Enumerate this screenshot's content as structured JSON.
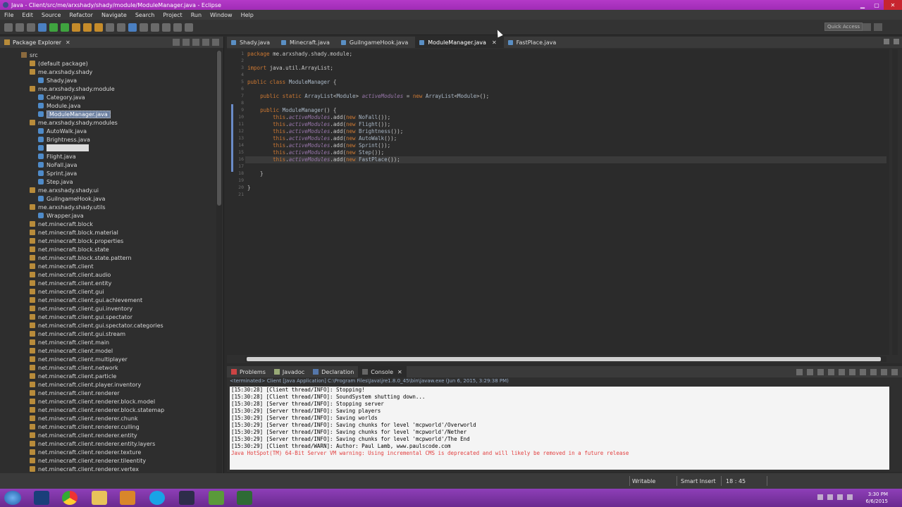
{
  "window": {
    "title": "Java - Client/src/me/arxshady/shady/module/ModuleManager.java - Eclipse"
  },
  "menu": [
    "File",
    "Edit",
    "Source",
    "Refactor",
    "Navigate",
    "Search",
    "Project",
    "Run",
    "Window",
    "Help"
  ],
  "toolbar": {
    "quick_access": "Quick Access"
  },
  "package_explorer": {
    "title": "Package Explorer",
    "tree": [
      {
        "label": "src",
        "kind": "src",
        "indent": 0
      },
      {
        "label": "(default package)",
        "kind": "pkg",
        "indent": 1
      },
      {
        "label": "me.arxshady.shady",
        "kind": "pkg",
        "indent": 1
      },
      {
        "label": "Shady.java",
        "kind": "file",
        "indent": 2
      },
      {
        "label": "me.arxshady.shady.module",
        "kind": "pkg",
        "indent": 1
      },
      {
        "label": "Category.java",
        "kind": "file",
        "indent": 2
      },
      {
        "label": "Module.java",
        "kind": "file",
        "indent": 2
      },
      {
        "label": "ModuleManager.java",
        "kind": "file",
        "indent": 2,
        "selected": true
      },
      {
        "label": "me.arxshady.shady.modules",
        "kind": "pkg",
        "indent": 1
      },
      {
        "label": "AutoWalk.java",
        "kind": "file",
        "indent": 2
      },
      {
        "label": "Brightness.java",
        "kind": "file",
        "indent": 2
      },
      {
        "label": "",
        "kind": "file",
        "indent": 2,
        "editing": true
      },
      {
        "label": "Flight.java",
        "kind": "file",
        "indent": 2
      },
      {
        "label": "NoFall.java",
        "kind": "file",
        "indent": 2
      },
      {
        "label": "Sprint.java",
        "kind": "file",
        "indent": 2
      },
      {
        "label": "Step.java",
        "kind": "file",
        "indent": 2
      },
      {
        "label": "me.arxshady.shady.ui",
        "kind": "pkg",
        "indent": 1
      },
      {
        "label": "GuiIngameHook.java",
        "kind": "file",
        "indent": 2
      },
      {
        "label": "me.arxshady.shady.utils",
        "kind": "pkg",
        "indent": 1
      },
      {
        "label": "Wrapper.java",
        "kind": "file",
        "indent": 2
      },
      {
        "label": "net.minecraft.block",
        "kind": "pkg",
        "indent": 1
      },
      {
        "label": "net.minecraft.block.material",
        "kind": "pkg",
        "indent": 1
      },
      {
        "label": "net.minecraft.block.properties",
        "kind": "pkg",
        "indent": 1
      },
      {
        "label": "net.minecraft.block.state",
        "kind": "pkg",
        "indent": 1
      },
      {
        "label": "net.minecraft.block.state.pattern",
        "kind": "pkg",
        "indent": 1
      },
      {
        "label": "net.minecraft.client",
        "kind": "pkg",
        "indent": 1
      },
      {
        "label": "net.minecraft.client.audio",
        "kind": "pkg",
        "indent": 1
      },
      {
        "label": "net.minecraft.client.entity",
        "kind": "pkg",
        "indent": 1
      },
      {
        "label": "net.minecraft.client.gui",
        "kind": "pkg",
        "indent": 1
      },
      {
        "label": "net.minecraft.client.gui.achievement",
        "kind": "pkg",
        "indent": 1
      },
      {
        "label": "net.minecraft.client.gui.inventory",
        "kind": "pkg",
        "indent": 1
      },
      {
        "label": "net.minecraft.client.gui.spectator",
        "kind": "pkg",
        "indent": 1
      },
      {
        "label": "net.minecraft.client.gui.spectator.categories",
        "kind": "pkg",
        "indent": 1
      },
      {
        "label": "net.minecraft.client.gui.stream",
        "kind": "pkg",
        "indent": 1
      },
      {
        "label": "net.minecraft.client.main",
        "kind": "pkg",
        "indent": 1
      },
      {
        "label": "net.minecraft.client.model",
        "kind": "pkg",
        "indent": 1
      },
      {
        "label": "net.minecraft.client.multiplayer",
        "kind": "pkg",
        "indent": 1
      },
      {
        "label": "net.minecraft.client.network",
        "kind": "pkg",
        "indent": 1
      },
      {
        "label": "net.minecraft.client.particle",
        "kind": "pkg",
        "indent": 1
      },
      {
        "label": "net.minecraft.client.player.inventory",
        "kind": "pkg",
        "indent": 1
      },
      {
        "label": "net.minecraft.client.renderer",
        "kind": "pkg",
        "indent": 1
      },
      {
        "label": "net.minecraft.client.renderer.block.model",
        "kind": "pkg",
        "indent": 1
      },
      {
        "label": "net.minecraft.client.renderer.block.statemap",
        "kind": "pkg",
        "indent": 1
      },
      {
        "label": "net.minecraft.client.renderer.chunk",
        "kind": "pkg",
        "indent": 1
      },
      {
        "label": "net.minecraft.client.renderer.culling",
        "kind": "pkg",
        "indent": 1
      },
      {
        "label": "net.minecraft.client.renderer.entity",
        "kind": "pkg",
        "indent": 1
      },
      {
        "label": "net.minecraft.client.renderer.entity.layers",
        "kind": "pkg",
        "indent": 1
      },
      {
        "label": "net.minecraft.client.renderer.texture",
        "kind": "pkg",
        "indent": 1
      },
      {
        "label": "net.minecraft.client.renderer.tileentity",
        "kind": "pkg",
        "indent": 1
      },
      {
        "label": "net.minecraft.client.renderer.vertex",
        "kind": "pkg",
        "indent": 1
      }
    ]
  },
  "editor": {
    "tabs": [
      {
        "label": "Shady.java",
        "active": false
      },
      {
        "label": "Minecraft.java",
        "active": false
      },
      {
        "label": "GuiIngameHook.java",
        "active": false
      },
      {
        "label": "ModuleManager.java",
        "active": true
      },
      {
        "label": "FastPlace.java",
        "active": false
      }
    ],
    "lines": [
      {
        "n": "1",
        "tokens": [
          [
            "kw",
            "package "
          ],
          [
            "dflt",
            "me.arxshady.shady.module;"
          ]
        ]
      },
      {
        "n": "2",
        "tokens": []
      },
      {
        "n": "3",
        "tokens": [
          [
            "kw",
            "import "
          ],
          [
            "dflt",
            "java.util.ArrayList;"
          ]
        ]
      },
      {
        "n": "4",
        "tokens": []
      },
      {
        "n": "5",
        "tokens": [
          [
            "kw",
            "public class "
          ],
          [
            "cls",
            "ModuleManager "
          ],
          [
            "dflt",
            "{"
          ]
        ]
      },
      {
        "n": "6",
        "tokens": []
      },
      {
        "n": "7",
        "tokens": [
          [
            "dflt",
            "    "
          ],
          [
            "kw",
            "public static "
          ],
          [
            "cls",
            "ArrayList"
          ],
          [
            "dflt",
            "<"
          ],
          [
            "cls",
            "Module"
          ],
          [
            "dflt",
            "> "
          ],
          [
            "fld",
            "activeModules"
          ],
          [
            "dflt",
            " = "
          ],
          [
            "kw",
            "new "
          ],
          [
            "cls",
            "ArrayList"
          ],
          [
            "dflt",
            "<"
          ],
          [
            "cls",
            "Module"
          ],
          [
            "dflt",
            ">();"
          ]
        ]
      },
      {
        "n": "8",
        "tokens": []
      },
      {
        "n": "9",
        "tokens": [
          [
            "dflt",
            "    "
          ],
          [
            "kw",
            "public "
          ],
          [
            "cls",
            "ModuleManager"
          ],
          [
            "dflt",
            "() {"
          ]
        ]
      },
      {
        "n": "10",
        "tokens": [
          [
            "dflt",
            "        "
          ],
          [
            "kw",
            "this"
          ],
          [
            "dflt",
            "."
          ],
          [
            "fld",
            "activeModules"
          ],
          [
            "dflt",
            ".add("
          ],
          [
            "kw",
            "new "
          ],
          [
            "cls",
            "NoFall"
          ],
          [
            "dflt",
            "());"
          ]
        ]
      },
      {
        "n": "11",
        "tokens": [
          [
            "dflt",
            "        "
          ],
          [
            "kw",
            "this"
          ],
          [
            "dflt",
            "."
          ],
          [
            "fld",
            "activeModules"
          ],
          [
            "dflt",
            ".add("
          ],
          [
            "kw",
            "new "
          ],
          [
            "cls",
            "Flight"
          ],
          [
            "dflt",
            "());"
          ]
        ]
      },
      {
        "n": "12",
        "tokens": [
          [
            "dflt",
            "        "
          ],
          [
            "kw",
            "this"
          ],
          [
            "dflt",
            "."
          ],
          [
            "fld",
            "activeModules"
          ],
          [
            "dflt",
            ".add("
          ],
          [
            "kw",
            "new "
          ],
          [
            "cls",
            "Brightness"
          ],
          [
            "dflt",
            "());"
          ]
        ]
      },
      {
        "n": "13",
        "tokens": [
          [
            "dflt",
            "        "
          ],
          [
            "kw",
            "this"
          ],
          [
            "dflt",
            "."
          ],
          [
            "fld",
            "activeModules"
          ],
          [
            "dflt",
            ".add("
          ],
          [
            "kw",
            "new "
          ],
          [
            "cls",
            "AutoWalk"
          ],
          [
            "dflt",
            "());"
          ]
        ]
      },
      {
        "n": "14",
        "tokens": [
          [
            "dflt",
            "        "
          ],
          [
            "kw",
            "this"
          ],
          [
            "dflt",
            "."
          ],
          [
            "fld",
            "activeModules"
          ],
          [
            "dflt",
            ".add("
          ],
          [
            "kw",
            "new "
          ],
          [
            "cls",
            "Sprint"
          ],
          [
            "dflt",
            "());"
          ]
        ]
      },
      {
        "n": "15",
        "tokens": [
          [
            "dflt",
            "        "
          ],
          [
            "kw",
            "this"
          ],
          [
            "dflt",
            "."
          ],
          [
            "fld",
            "activeModules"
          ],
          [
            "dflt",
            ".add("
          ],
          [
            "kw",
            "new "
          ],
          [
            "cls",
            "Step"
          ],
          [
            "dflt",
            "());"
          ]
        ]
      },
      {
        "n": "16",
        "tokens": [
          [
            "dflt",
            "        "
          ],
          [
            "kw",
            "this"
          ],
          [
            "dflt",
            "."
          ],
          [
            "fld",
            "activeModules"
          ],
          [
            "dflt",
            ".add("
          ],
          [
            "kw",
            "new "
          ],
          [
            "cls",
            "FastPlace"
          ],
          [
            "dflt",
            "());"
          ]
        ],
        "highlight": true
      },
      {
        "n": "17",
        "tokens": []
      },
      {
        "n": "18",
        "tokens": [
          [
            "dflt",
            "    }"
          ]
        ]
      },
      {
        "n": "19",
        "tokens": []
      },
      {
        "n": "20",
        "tokens": [
          [
            "dflt",
            "}"
          ]
        ]
      },
      {
        "n": "21",
        "tokens": []
      }
    ]
  },
  "console": {
    "tabs": [
      {
        "label": "Problems",
        "active": false
      },
      {
        "label": "Javadoc",
        "active": false
      },
      {
        "label": "Declaration",
        "active": false
      },
      {
        "label": "Console",
        "active": true
      }
    ],
    "terminated": "<terminated> Client [Java Application] C:\\Program Files\\Java\\jre1.8.0_45\\bin\\javaw.exe (Jun 6, 2015, 3:29:38 PM)",
    "lines": [
      {
        "text": "[15:30:28] [Client thread/INFO]: Stopping!",
        "error": false
      },
      {
        "text": "[15:30:28] [Client thread/INFO]: SoundSystem shutting down...",
        "error": false
      },
      {
        "text": "[15:30:28] [Server thread/INFO]: Stopping server",
        "error": false
      },
      {
        "text": "[15:30:29] [Server thread/INFO]: Saving players",
        "error": false
      },
      {
        "text": "[15:30:29] [Server thread/INFO]: Saving worlds",
        "error": false
      },
      {
        "text": "[15:30:29] [Server thread/INFO]: Saving chunks for level 'mcpworld'/Overworld",
        "error": false
      },
      {
        "text": "[15:30:29] [Server thread/INFO]: Saving chunks for level 'mcpworld'/Nether",
        "error": false
      },
      {
        "text": "[15:30:29] [Server thread/INFO]: Saving chunks for level 'mcpworld'/The End",
        "error": false
      },
      {
        "text": "[15:30:29] [Client thread/WARN]: Author: Paul Lamb, www.paulscode.com",
        "error": false
      },
      {
        "text": "Java HotSpot(TM) 64-Bit Server VM warning: Using incremental CMS is deprecated and will likely be removed in a future release",
        "error": true
      }
    ]
  },
  "status": {
    "writable": "Writable",
    "insert_mode": "Smart Insert",
    "position": "18 : 45"
  },
  "taskbar": {
    "time": "3:30 PM",
    "date": "6/6/2015"
  },
  "colors": {
    "titlebar": "#a02cb6",
    "taskbar": "#7a349f",
    "keyword": "#cc7832",
    "field": "#9876aa",
    "error": "#e24040"
  }
}
